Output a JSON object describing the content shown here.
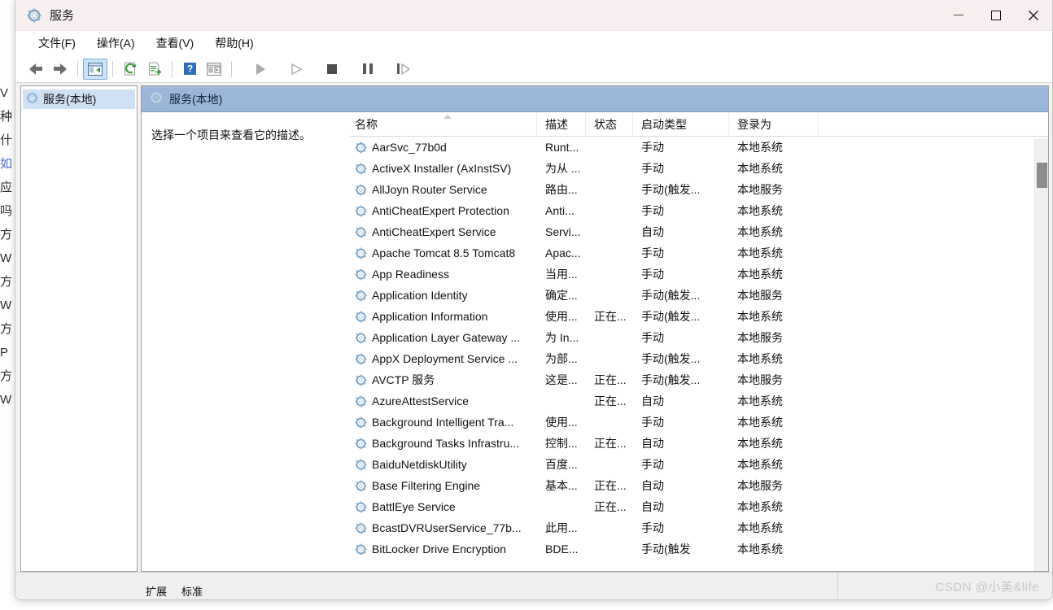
{
  "background_page": {
    "lines": [
      "V",
      "种",
      "什",
      "如",
      "应",
      "吗",
      "方",
      "W",
      "方",
      "W",
      "方",
      "P",
      "方",
      "W"
    ],
    "link_line_index": 3
  },
  "window": {
    "title": "服务",
    "icon": "services-gear-icon",
    "controls": {
      "minimize": "minimize-icon",
      "maximize": "maximize-icon",
      "close": "close-icon"
    }
  },
  "menubar": {
    "items": [
      {
        "label": "文件(F)",
        "name": "menu-file"
      },
      {
        "label": "操作(A)",
        "name": "menu-action"
      },
      {
        "label": "查看(V)",
        "name": "menu-view"
      },
      {
        "label": "帮助(H)",
        "name": "menu-help"
      }
    ]
  },
  "toolbar": {
    "buttons": [
      {
        "name": "back-button",
        "icon": "arrow-left-icon",
        "tip": "后退"
      },
      {
        "name": "forward-button",
        "icon": "arrow-right-icon",
        "tip": "前进"
      },
      {
        "name": "show-hide-console-tree-button",
        "icon": "console-tree-icon",
        "tip": "显示/隐藏控制台树",
        "selected": true
      },
      {
        "name": "refresh-button",
        "icon": "refresh-icon",
        "tip": "刷新"
      },
      {
        "name": "export-list-button",
        "icon": "export-list-icon",
        "tip": "导出列表"
      },
      {
        "name": "help-button",
        "icon": "help-icon",
        "tip": "帮助"
      },
      {
        "name": "show-action-pane-button",
        "icon": "action-pane-icon",
        "tip": "显示/隐藏操作窗格"
      },
      {
        "name": "start-service-button",
        "icon": "play-icon",
        "tip": "启动服务"
      },
      {
        "name": "resume-service-button",
        "icon": "play-outline-icon",
        "tip": "恢复服务"
      },
      {
        "name": "stop-service-button",
        "icon": "stop-icon",
        "tip": "停止服务"
      },
      {
        "name": "pause-service-button",
        "icon": "pause-icon",
        "tip": "暂停服务"
      },
      {
        "name": "restart-service-button",
        "icon": "restart-icon",
        "tip": "重启服务"
      }
    ]
  },
  "tree": {
    "nodes": [
      {
        "label": "服务(本地)",
        "icon": "services-gear-icon",
        "selected": true
      }
    ]
  },
  "pane": {
    "header_title": "服务(本地)",
    "header_icon": "services-gear-icon",
    "description_placeholder": "选择一个项目来查看它的描述。"
  },
  "list": {
    "columns": [
      {
        "label": "名称",
        "name": "col-name",
        "sorted": true
      },
      {
        "label": "描述",
        "name": "col-description"
      },
      {
        "label": "状态",
        "name": "col-status"
      },
      {
        "label": "启动类型",
        "name": "col-startup-type"
      },
      {
        "label": "登录为",
        "name": "col-log-on-as"
      }
    ],
    "rows": [
      {
        "name": "AarSvc_77b0d",
        "description": "Runt...",
        "status": "",
        "startup": "手动",
        "logon": "本地系统"
      },
      {
        "name": "ActiveX Installer (AxInstSV)",
        "description": "为从 ...",
        "status": "",
        "startup": "手动",
        "logon": "本地系统"
      },
      {
        "name": "AllJoyn Router Service",
        "description": "路由...",
        "status": "",
        "startup": "手动(触发...",
        "logon": "本地服务"
      },
      {
        "name": "AntiCheatExpert Protection",
        "description": "Anti...",
        "status": "",
        "startup": "手动",
        "logon": "本地系统"
      },
      {
        "name": "AntiCheatExpert Service",
        "description": "Servi...",
        "status": "",
        "startup": "自动",
        "logon": "本地系统"
      },
      {
        "name": "Apache Tomcat 8.5 Tomcat8",
        "description": "Apac...",
        "status": "",
        "startup": "手动",
        "logon": "本地系统"
      },
      {
        "name": "App Readiness",
        "description": "当用...",
        "status": "",
        "startup": "手动",
        "logon": "本地系统"
      },
      {
        "name": "Application Identity",
        "description": "确定...",
        "status": "",
        "startup": "手动(触发...",
        "logon": "本地服务"
      },
      {
        "name": "Application Information",
        "description": "使用...",
        "status": "正在...",
        "startup": "手动(触发...",
        "logon": "本地系统"
      },
      {
        "name": "Application Layer Gateway ...",
        "description": "为 In...",
        "status": "",
        "startup": "手动",
        "logon": "本地服务"
      },
      {
        "name": "AppX Deployment Service ...",
        "description": "为部...",
        "status": "",
        "startup": "手动(触发...",
        "logon": "本地系统"
      },
      {
        "name": "AVCTP 服务",
        "description": "这是...",
        "status": "正在...",
        "startup": "手动(触发...",
        "logon": "本地服务"
      },
      {
        "name": "AzureAttestService",
        "description": "",
        "status": "正在...",
        "startup": "自动",
        "logon": "本地系统"
      },
      {
        "name": "Background Intelligent Tra...",
        "description": "使用...",
        "status": "",
        "startup": "手动",
        "logon": "本地系统"
      },
      {
        "name": "Background Tasks Infrastru...",
        "description": "控制...",
        "status": "正在...",
        "startup": "自动",
        "logon": "本地系统"
      },
      {
        "name": "BaiduNetdiskUtility",
        "description": "百度...",
        "status": "",
        "startup": "手动",
        "logon": "本地系统"
      },
      {
        "name": "Base Filtering Engine",
        "description": "基本...",
        "status": "正在...",
        "startup": "自动",
        "logon": "本地服务"
      },
      {
        "name": "BattlEye Service",
        "description": "",
        "status": "正在...",
        "startup": "自动",
        "logon": "本地系统"
      },
      {
        "name": "BcastDVRUserService_77b...",
        "description": "此用...",
        "status": "",
        "startup": "手动",
        "logon": "本地系统"
      },
      {
        "name": "BitLocker Drive Encryption",
        "description": "BDE...",
        "status": "",
        "startup": "手动(触发",
        "logon": "本地系统"
      }
    ]
  },
  "tabs": [
    {
      "label": "扩展",
      "name": "tab-extended",
      "active": false
    },
    {
      "label": "标准",
      "name": "tab-standard",
      "active": true
    }
  ],
  "statusbar": {
    "watermark": "CSDN @小美&life"
  },
  "colors": {
    "titlebar": "#f7efef",
    "pane_header": "#9bb6d8",
    "tree_selection": "#cfe0f4",
    "toolbar_selected": "#cce4f7",
    "scrollbar_thumb": "#8c8c8c"
  }
}
